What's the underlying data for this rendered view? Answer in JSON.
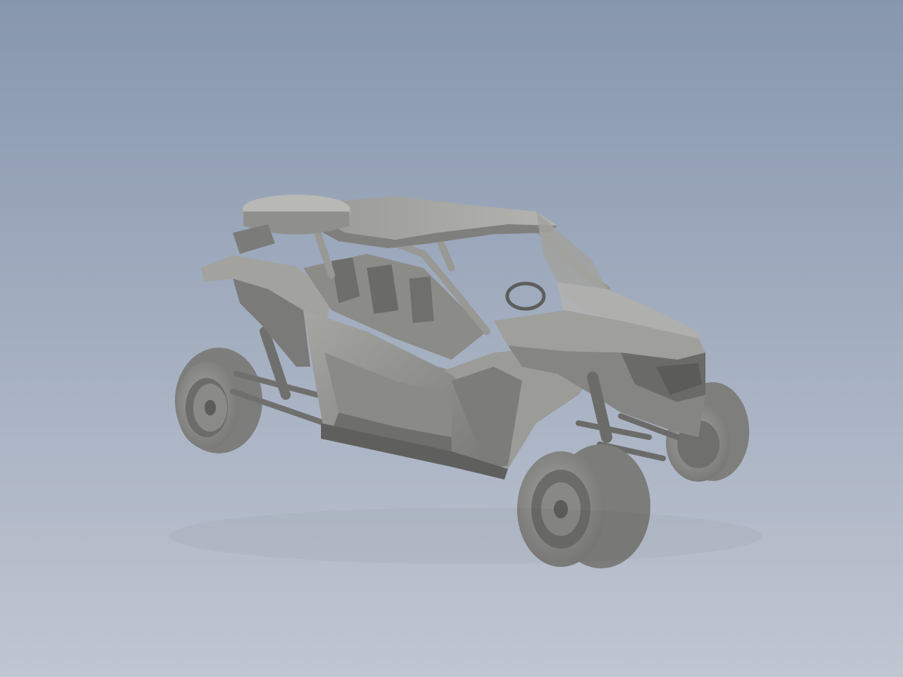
{
  "viewport": {
    "background_top": "#8797ae",
    "background_bottom": "#c0c6d2"
  },
  "model": {
    "body_color": "#8e8e8c",
    "dark_color": "#6f6f6d",
    "light_color": "#a9a9a6",
    "highlight_color": "#b9b9b6",
    "shadow_color": "#57575a"
  }
}
